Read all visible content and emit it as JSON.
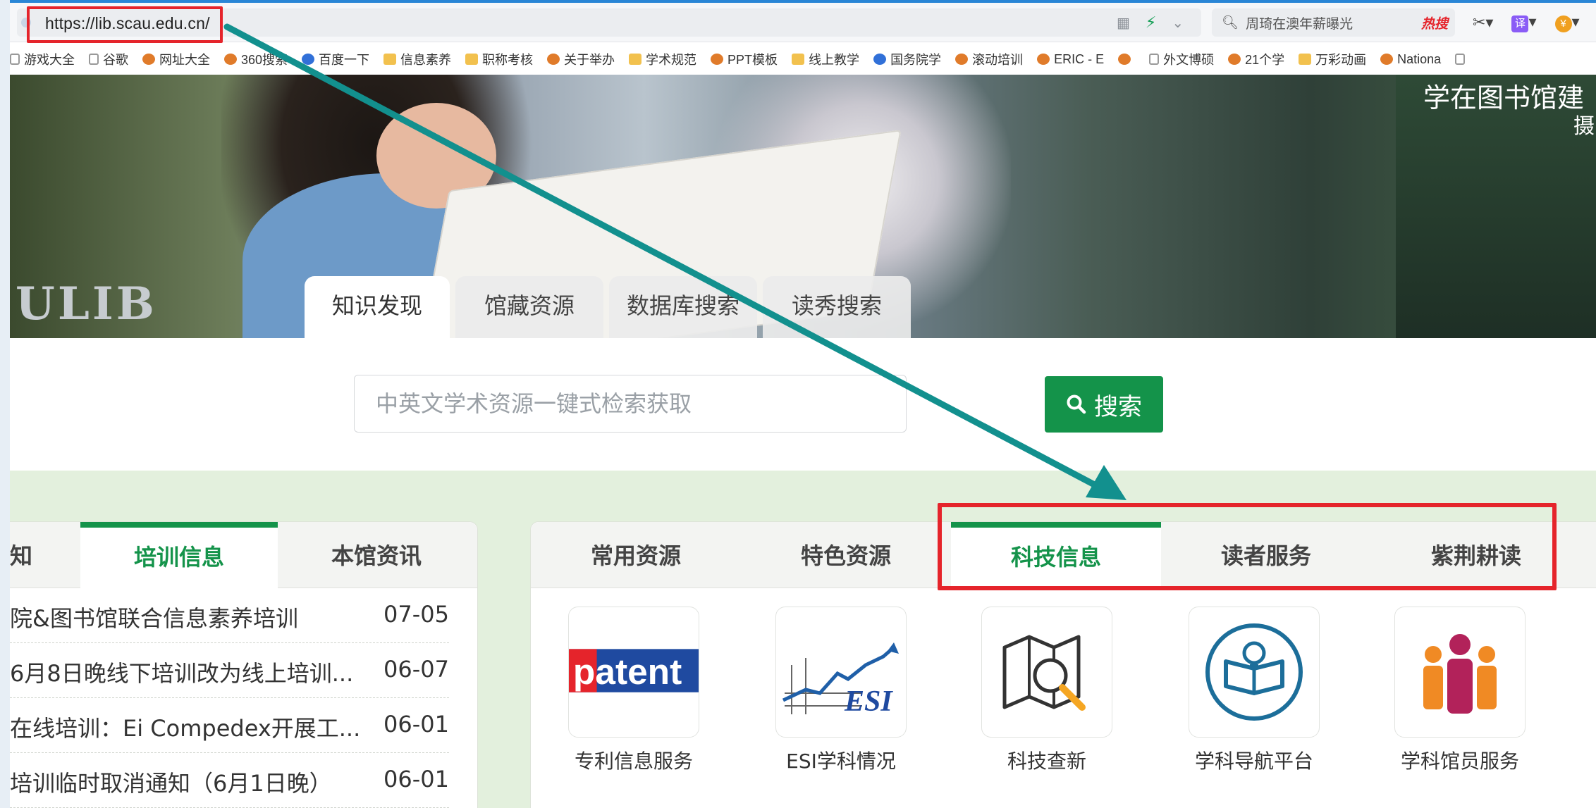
{
  "browser": {
    "url": "https://lib.scau.edu.cn/",
    "search_box_text": "周琦在澳年薪曝光",
    "hot_search_label": "热搜",
    "extension_icons": [
      "scissors-icon",
      "translate-icon",
      "wallet-icon"
    ],
    "bookmarks": [
      {
        "label": "游戏大全",
        "icon": "page"
      },
      {
        "label": "谷歌",
        "icon": "page"
      },
      {
        "label": "网址大全",
        "icon": "round"
      },
      {
        "label": "360搜索",
        "icon": "round"
      },
      {
        "label": "百度一下",
        "icon": "paw"
      },
      {
        "label": "信息素养",
        "icon": "folder"
      },
      {
        "label": "职称考核",
        "icon": "folder"
      },
      {
        "label": "关于举办",
        "icon": "round"
      },
      {
        "label": "学术规范",
        "icon": "folder"
      },
      {
        "label": "PPT模板",
        "icon": "round"
      },
      {
        "label": "线上教学",
        "icon": "folder"
      },
      {
        "label": "国务院学",
        "icon": "paw"
      },
      {
        "label": "滚动培训",
        "icon": "round"
      },
      {
        "label": "ERIC - E",
        "icon": "round"
      },
      {
        "label": "",
        "icon": "round"
      },
      {
        "label": "外文博硕",
        "icon": "page"
      },
      {
        "label": "21个学",
        "icon": "round"
      },
      {
        "label": "万彩动画",
        "icon": "folder"
      },
      {
        "label": "Nationa",
        "icon": "round"
      },
      {
        "label": "",
        "icon": "page"
      }
    ]
  },
  "hero": {
    "caption_line1": "学在图书馆建",
    "caption_line2": "摄",
    "logo_text": "ULIB",
    "slide_count": 8,
    "active_slide": 1
  },
  "search": {
    "tabs": [
      "知识发现",
      "馆藏资源",
      "数据库搜索",
      "读秀搜索"
    ],
    "active_tab": "知识发现",
    "placeholder": "中英文学术资源一键式检索获取",
    "button_label": "搜索"
  },
  "news_panel": {
    "tabs": [
      "知",
      "培训信息",
      "本馆资讯"
    ],
    "active_tab": "培训信息",
    "items": [
      {
        "title": "院&图书馆联合信息素养培训",
        "date": "07-05"
      },
      {
        "title": "6月8日晚线下培训改为线上培训...",
        "date": "06-07"
      },
      {
        "title": "在线培训：Ei Compedex开展工...",
        "date": "06-01"
      },
      {
        "title": "培训临时取消通知（6月1日晚）",
        "date": "06-01"
      }
    ]
  },
  "resource_panel": {
    "tabs": [
      "常用资源",
      "特色资源",
      "科技信息",
      "读者服务",
      "紫荆耕读"
    ],
    "active_tab": "科技信息",
    "items": [
      {
        "label": "专利信息服务",
        "icon": "patent-logo-icon",
        "logo_text": "patent"
      },
      {
        "label": "ESI学科情况",
        "icon": "esi-chart-icon",
        "logo_text": "ESI"
      },
      {
        "label": "科技查新",
        "icon": "map-magnifier-icon"
      },
      {
        "label": "学科导航平台",
        "icon": "book-bulb-icon"
      },
      {
        "label": "学科馆员服务",
        "icon": "people-group-icon"
      }
    ]
  },
  "annotations": {
    "highlight_color": "#e5242b",
    "arrow_color": "#12908e"
  },
  "colors": {
    "brand_green": "#14934a",
    "lower_bg": "#e3f0dd"
  }
}
